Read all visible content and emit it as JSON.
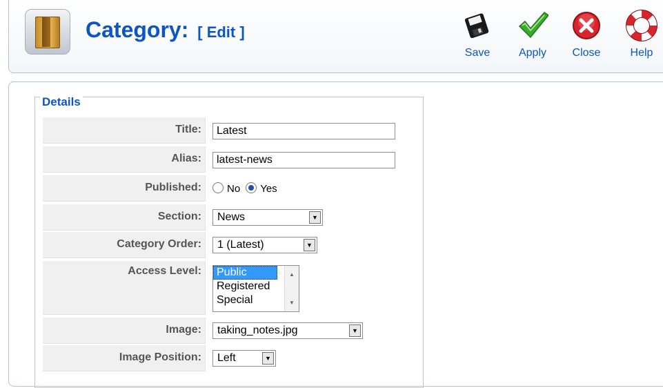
{
  "header": {
    "title": "Category:",
    "subtitle": "[ Edit ]",
    "icon": "category-folder-icon"
  },
  "toolbar": {
    "save_label": "Save",
    "apply_label": "Apply",
    "close_label": "Close",
    "help_label": "Help"
  },
  "details": {
    "legend": "Details",
    "title_label": "Title:",
    "title_value": "Latest",
    "alias_label": "Alias:",
    "alias_value": "latest-news",
    "published_label": "Published:",
    "published_options": [
      "No",
      "Yes"
    ],
    "published_selected": "Yes",
    "section_label": "Section:",
    "section_value": "News",
    "category_order_label": "Category Order:",
    "category_order_value": "1 (Latest)",
    "access_level_label": "Access Level:",
    "access_level_options": [
      "Public",
      "Registered",
      "Special"
    ],
    "access_level_selected": "Public",
    "image_label": "Image:",
    "image_value": "taking_notes.jpg",
    "image_position_label": "Image Position:",
    "image_position_value": "Left"
  },
  "colors": {
    "accent": "#0b55c4",
    "selection": "#3399ff",
    "label_bg": "#f0f0f0"
  }
}
